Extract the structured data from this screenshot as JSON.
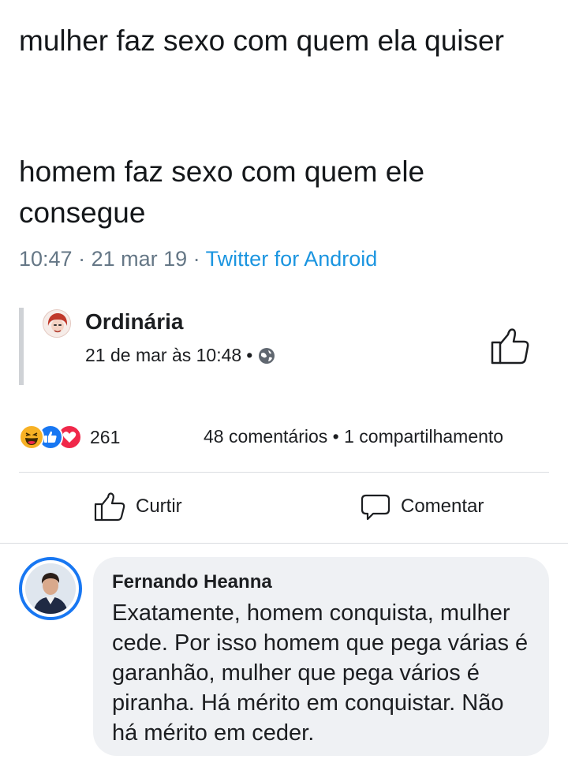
{
  "tweet": {
    "line1": "mulher faz sexo com quem ela quiser",
    "line2": "homem faz sexo com quem ele consegue",
    "time": "10:47",
    "separator": " · ",
    "date": "21 mar 19",
    "source": "Twitter for Android"
  },
  "shared_post": {
    "page_name": "Ordinária",
    "timestamp": "21 de mar às 10:48",
    "dot": "•",
    "privacy_icon": "globe-icon",
    "like_icon": "thumbs-up-icon"
  },
  "reactions": {
    "icons": [
      "haha-icon",
      "like-icon",
      "love-icon"
    ],
    "count": "261",
    "comments": "48 comentários",
    "bullet": "•",
    "shares": "1 compartilhamento"
  },
  "actions": {
    "like_label": "Curtir",
    "comment_label": "Comentar"
  },
  "comment": {
    "author": "Fernando Heanna",
    "text": "Exatamente, homem conquista, mulher cede. Por isso homem que pega várias é garanhão, mulher que pega vários é piranha. Há mérito em conquistar. Não há mérito em ceder."
  },
  "colors": {
    "twitter_blue": "#1b95e0",
    "facebook_blue": "#1877f2",
    "love_red": "#f0284a",
    "haha_yellow": "#f7b125",
    "bubble_gray": "#eff1f4"
  }
}
